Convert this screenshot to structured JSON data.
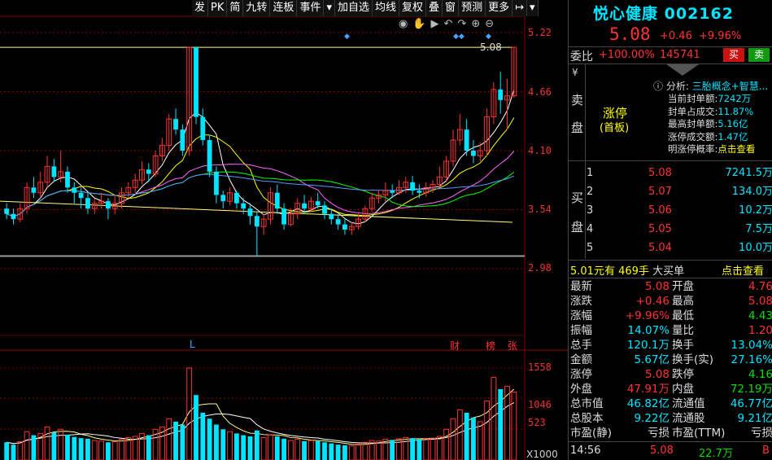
{
  "toolbar": [
    "发",
    "PK",
    "简",
    "九转",
    "连板",
    "事件",
    "▾",
    "加自选",
    "均线",
    "复权",
    "叠",
    "窗",
    "预测",
    "更多",
    "↦",
    "▾"
  ],
  "chart": {
    "price_ticks": [
      "5.22",
      "4.66",
      "4.10",
      "3.54",
      "2.98"
    ],
    "volume_ticks": [
      "1558",
      "1046",
      "523"
    ],
    "volume_unit": "X1000",
    "high_label": "5.08",
    "markers": {
      "l": "L",
      "cai": "财",
      "bang": "榜",
      "zhang": "张"
    }
  },
  "chart_data": {
    "type": "candlestick",
    "ylim": [
      2.98,
      5.22
    ],
    "volume_ylim": [
      0,
      1558
    ],
    "candles": [
      [
        3.55,
        3.5,
        3.6,
        3.45,
        300
      ],
      [
        3.5,
        3.45,
        3.55,
        3.4,
        260
      ],
      [
        3.45,
        3.55,
        3.6,
        3.42,
        310
      ],
      [
        3.55,
        3.75,
        3.8,
        3.5,
        480
      ],
      [
        3.75,
        3.7,
        3.85,
        3.65,
        420
      ],
      [
        3.7,
        3.8,
        3.9,
        3.65,
        450
      ],
      [
        3.8,
        3.95,
        4.05,
        3.75,
        560
      ],
      [
        3.95,
        3.85,
        4.02,
        3.8,
        470
      ],
      [
        3.85,
        3.9,
        4.1,
        3.8,
        520
      ],
      [
        3.9,
        3.75,
        3.95,
        3.7,
        430
      ],
      [
        3.75,
        3.7,
        3.8,
        3.6,
        390
      ],
      [
        3.7,
        3.65,
        3.75,
        3.55,
        370
      ],
      [
        3.65,
        3.55,
        3.7,
        3.5,
        360
      ],
      [
        3.55,
        3.6,
        3.65,
        3.5,
        330
      ],
      [
        3.6,
        3.62,
        3.7,
        3.55,
        320
      ],
      [
        3.62,
        3.55,
        3.65,
        3.45,
        300
      ],
      [
        3.55,
        3.6,
        3.68,
        3.5,
        310
      ],
      [
        3.6,
        3.7,
        3.75,
        3.55,
        350
      ],
      [
        3.7,
        3.75,
        3.8,
        3.65,
        380
      ],
      [
        3.75,
        3.82,
        3.88,
        3.7,
        400
      ],
      [
        3.82,
        3.92,
        4.0,
        3.78,
        450
      ],
      [
        3.92,
        3.88,
        3.98,
        3.8,
        420
      ],
      [
        3.88,
        4.05,
        4.1,
        3.85,
        520
      ],
      [
        4.05,
        4.15,
        4.22,
        4.0,
        560
      ],
      [
        4.15,
        4.4,
        4.45,
        4.1,
        700
      ],
      [
        4.4,
        4.3,
        4.5,
        4.25,
        650
      ],
      [
        4.3,
        4.1,
        4.35,
        4.05,
        600
      ],
      [
        4.1,
        5.08,
        5.08,
        4.05,
        1558
      ],
      [
        5.08,
        4.42,
        5.08,
        4.35,
        1100
      ],
      [
        4.42,
        4.2,
        4.5,
        4.15,
        800
      ],
      [
        4.2,
        3.9,
        4.25,
        3.85,
        700
      ],
      [
        3.9,
        3.68,
        3.95,
        3.6,
        600
      ],
      [
        3.68,
        3.62,
        3.72,
        3.55,
        520
      ],
      [
        3.62,
        3.7,
        3.75,
        3.58,
        480
      ],
      [
        3.7,
        3.6,
        3.72,
        3.55,
        450
      ],
      [
        3.6,
        3.55,
        3.65,
        3.5,
        420
      ],
      [
        3.55,
        3.48,
        3.6,
        3.4,
        400
      ],
      [
        3.48,
        3.38,
        3.52,
        3.1,
        500
      ],
      [
        3.38,
        3.45,
        3.5,
        3.3,
        380
      ],
      [
        3.45,
        3.7,
        3.75,
        3.4,
        430
      ],
      [
        3.7,
        3.55,
        3.78,
        3.5,
        400
      ],
      [
        3.55,
        3.4,
        3.6,
        3.35,
        360
      ],
      [
        3.4,
        3.5,
        3.55,
        3.38,
        330
      ],
      [
        3.5,
        3.6,
        3.65,
        3.45,
        350
      ],
      [
        3.6,
        3.55,
        3.68,
        3.5,
        320
      ],
      [
        3.55,
        3.62,
        3.66,
        3.52,
        330
      ],
      [
        3.62,
        3.58,
        3.7,
        3.55,
        320
      ],
      [
        3.58,
        3.5,
        3.62,
        3.45,
        300
      ],
      [
        3.5,
        3.45,
        3.55,
        3.4,
        280
      ],
      [
        3.45,
        3.4,
        3.5,
        3.35,
        260
      ],
      [
        3.4,
        3.35,
        3.45,
        3.3,
        250
      ],
      [
        3.35,
        3.38,
        3.42,
        3.3,
        240
      ],
      [
        3.38,
        3.45,
        3.5,
        3.35,
        270
      ],
      [
        3.45,
        3.55,
        3.58,
        3.42,
        300
      ],
      [
        3.55,
        3.65,
        3.7,
        3.52,
        330
      ],
      [
        3.65,
        3.68,
        3.72,
        3.6,
        320
      ],
      [
        3.68,
        3.72,
        3.8,
        3.62,
        350
      ],
      [
        3.72,
        3.7,
        3.78,
        3.65,
        340
      ],
      [
        3.7,
        3.75,
        3.82,
        3.68,
        360
      ],
      [
        3.75,
        3.8,
        3.85,
        3.7,
        380
      ],
      [
        3.8,
        3.72,
        3.86,
        3.68,
        370
      ],
      [
        3.72,
        3.7,
        3.78,
        3.65,
        350
      ],
      [
        3.7,
        3.75,
        3.8,
        3.66,
        360
      ],
      [
        3.75,
        3.78,
        3.82,
        3.7,
        370
      ],
      [
        3.78,
        3.85,
        3.95,
        3.75,
        400
      ],
      [
        3.85,
        4.0,
        4.05,
        3.8,
        520
      ],
      [
        4.0,
        4.2,
        4.3,
        3.95,
        700
      ],
      [
        4.2,
        4.3,
        4.45,
        4.15,
        850
      ],
      [
        4.3,
        4.1,
        4.4,
        4.05,
        800
      ],
      [
        4.1,
        4.05,
        4.2,
        3.98,
        720
      ],
      [
        4.05,
        4.1,
        4.18,
        4.0,
        650
      ],
      [
        4.1,
        4.42,
        4.5,
        4.05,
        1000
      ],
      [
        4.42,
        4.68,
        4.75,
        4.35,
        1400
      ],
      [
        4.68,
        4.58,
        4.85,
        4.45,
        1200
      ],
      [
        4.58,
        4.62,
        4.78,
        4.3,
        1250
      ],
      [
        4.62,
        5.08,
        5.08,
        4.6,
        1150
      ]
    ]
  },
  "stock": {
    "name": "悦心健康",
    "code": "002162",
    "price": "5.08",
    "change": "+0.46",
    "change_pct": "+9.96%"
  },
  "weibi": {
    "label": "委比",
    "pct": "+100.00%",
    "diff": "145741",
    "buy_btn": "买",
    "sell_btn": "卖"
  },
  "sell_side": {
    "label1": "卖",
    "label2": "盘",
    "yen": "¥",
    "limit_up": "涨停",
    "first_board": "(首板)"
  },
  "analysis": {
    "title": "分析:",
    "concept": "三胎概念+智慧...",
    "items": [
      {
        "k": "当前封单额:",
        "v": "7242万"
      },
      {
        "k": "封单占成交:",
        "v": "11.87%"
      },
      {
        "k": "最高封单额:",
        "v": "5.16亿"
      },
      {
        "k": "涨停成交额:",
        "v": "1.47亿"
      },
      {
        "k": "明涨停概率:",
        "v": "点击查看"
      }
    ]
  },
  "buy_side": {
    "label1": "买",
    "label2": "盘",
    "rows": [
      {
        "lvl": "1",
        "price": "5.08",
        "vol": "7241.5万"
      },
      {
        "lvl": "2",
        "price": "5.07",
        "vol": "134.0万"
      },
      {
        "lvl": "3",
        "price": "5.06",
        "vol": "10.2万"
      },
      {
        "lvl": "4",
        "price": "5.05",
        "vol": "7.5万"
      },
      {
        "lvl": "5",
        "price": "5.04",
        "vol": "10.0万"
      }
    ]
  },
  "big_order": {
    "price": "5.01元有",
    "qty": "469手",
    "desc": "大买单",
    "link": "点击查看"
  },
  "stats": [
    {
      "k1": "最新",
      "v1": "5.08",
      "c1": "red",
      "k2": "开盘",
      "v2": "4.76",
      "c2": "red"
    },
    {
      "k1": "涨跌",
      "v1": "+0.46",
      "c1": "red",
      "k2": "最高",
      "v2": "5.08",
      "c2": "red"
    },
    {
      "k1": "涨幅",
      "v1": "+9.96%",
      "c1": "red",
      "k2": "最低",
      "v2": "4.43",
      "c2": "green"
    },
    {
      "k1": "振幅",
      "v1": "14.07%",
      "c1": "cyan",
      "k2": "量比",
      "v2": "1.20",
      "c2": "red"
    },
    {
      "k1": "总手",
      "v1": "120.1万",
      "c1": "cyan",
      "k2": "换手",
      "v2": "13.04%",
      "c2": "cyan"
    },
    {
      "k1": "金额",
      "v1": "5.67亿",
      "c1": "cyan",
      "k2": "换手(实)",
      "v2": "27.16%",
      "c2": "cyan"
    },
    {
      "k1": "涨停",
      "v1": "5.08",
      "c1": "red",
      "k2": "跌停",
      "v2": "4.16",
      "c2": "green"
    },
    {
      "k1": "外盘",
      "v1": "47.91万",
      "c1": "red",
      "k2": "内盘",
      "v2": "72.19万",
      "c2": "green"
    },
    {
      "k1": "总市值",
      "v1": "46.82亿",
      "c1": "cyan",
      "k2": "流通值",
      "v2": "46.77亿",
      "c2": "cyan"
    },
    {
      "k1": "总股本",
      "v1": "9.22亿",
      "c1": "cyan",
      "k2": "流通股",
      "v2": "9.21亿",
      "c2": "cyan"
    },
    {
      "k1": "市盈(静)",
      "v1": "亏损",
      "c1": "white",
      "k2": "市盈(TTM)",
      "v2": "亏损",
      "c2": "white"
    }
  ],
  "tick": {
    "time": "14:56",
    "price": "5.08",
    "vol": "22.7万",
    "dir": "B"
  },
  "colors": {
    "up": "#ff3333",
    "down": "#00e5ff",
    "ma5": "#ffffff",
    "ma10": "#ffff00",
    "ma20": "#ff66ff",
    "ma30": "#00ff00",
    "ma60": "#5599ff"
  }
}
